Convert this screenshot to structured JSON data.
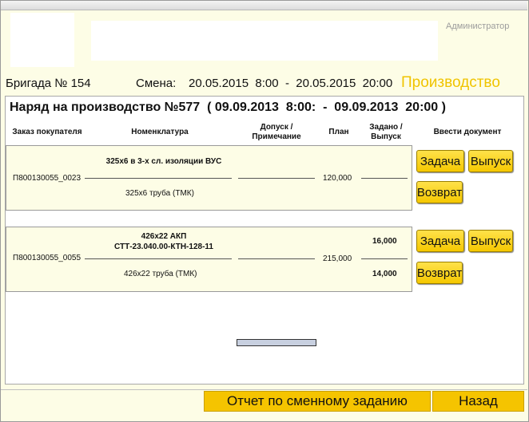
{
  "header": {
    "user": "Администратор",
    "brigade": "Бригада № 154",
    "shift_label": "Смена:",
    "shift_range": "20.05.2015  8:00  -  20.05.2015  20:00",
    "section": "Производство"
  },
  "order": {
    "title": "Наряд на производство №577  ( 09.09.2013  8:00:  -  09.09.2013  20:00 )"
  },
  "columns": {
    "customer_order": "Заказ покупателя",
    "nomenclature": "Номенклатура",
    "tolerance": "Допуск /\nПримечание",
    "plan": "План",
    "assigned": "Задано /\nВыпуск",
    "enter_doc": "Ввести документ"
  },
  "rows": [
    {
      "order": "П800130055_0023",
      "product": "325х6 в 3-х сл. изоляции ВУС",
      "material": "325х6 труба (ТМК)",
      "plan": "120,000",
      "assigned": "",
      "released": ""
    },
    {
      "order": "П800130055_0055",
      "product": "426х22 АКП\nСТТ-23.040.00-КТН-128-11",
      "material": "426х22 труба (ТМК)",
      "plan": "215,000",
      "assigned": "16,000",
      "released": "14,000"
    }
  ],
  "buttons": {
    "task": "Задача",
    "release": "Выпуск",
    "return": "Возврат",
    "shift_report": "Отчет по сменному заданию",
    "back": "Назад"
  }
}
